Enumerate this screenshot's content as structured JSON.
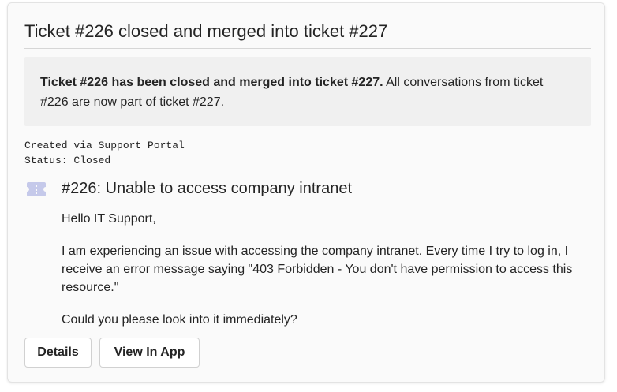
{
  "card": {
    "title": "Ticket #226 closed and merged into ticket #227",
    "notice": {
      "bold": "Ticket #226 has been closed and merged into ticket #227.",
      "rest": " All conversations from ticket #226 are now part of ticket #227."
    },
    "meta": {
      "created": "Created via Support Portal",
      "status": "Status: Closed"
    },
    "ticket": {
      "icon": "ticket-icon",
      "title": "#226: Unable to access company intranet",
      "greeting": "Hello IT Support,",
      "paragraph": "I am experiencing an issue with accessing the company intranet. Every time I try to log in, I receive an error message saying \"403 Forbidden - You don't have permission to access this resource.\"",
      "closing": "Could you please look into it immediately?"
    },
    "actions": {
      "details_label": "Details",
      "view_label": "View In App"
    }
  },
  "colors": {
    "icon_tint": "#c5c9ea",
    "card_background": "#fafafa",
    "notice_background": "#f0f0f0"
  }
}
